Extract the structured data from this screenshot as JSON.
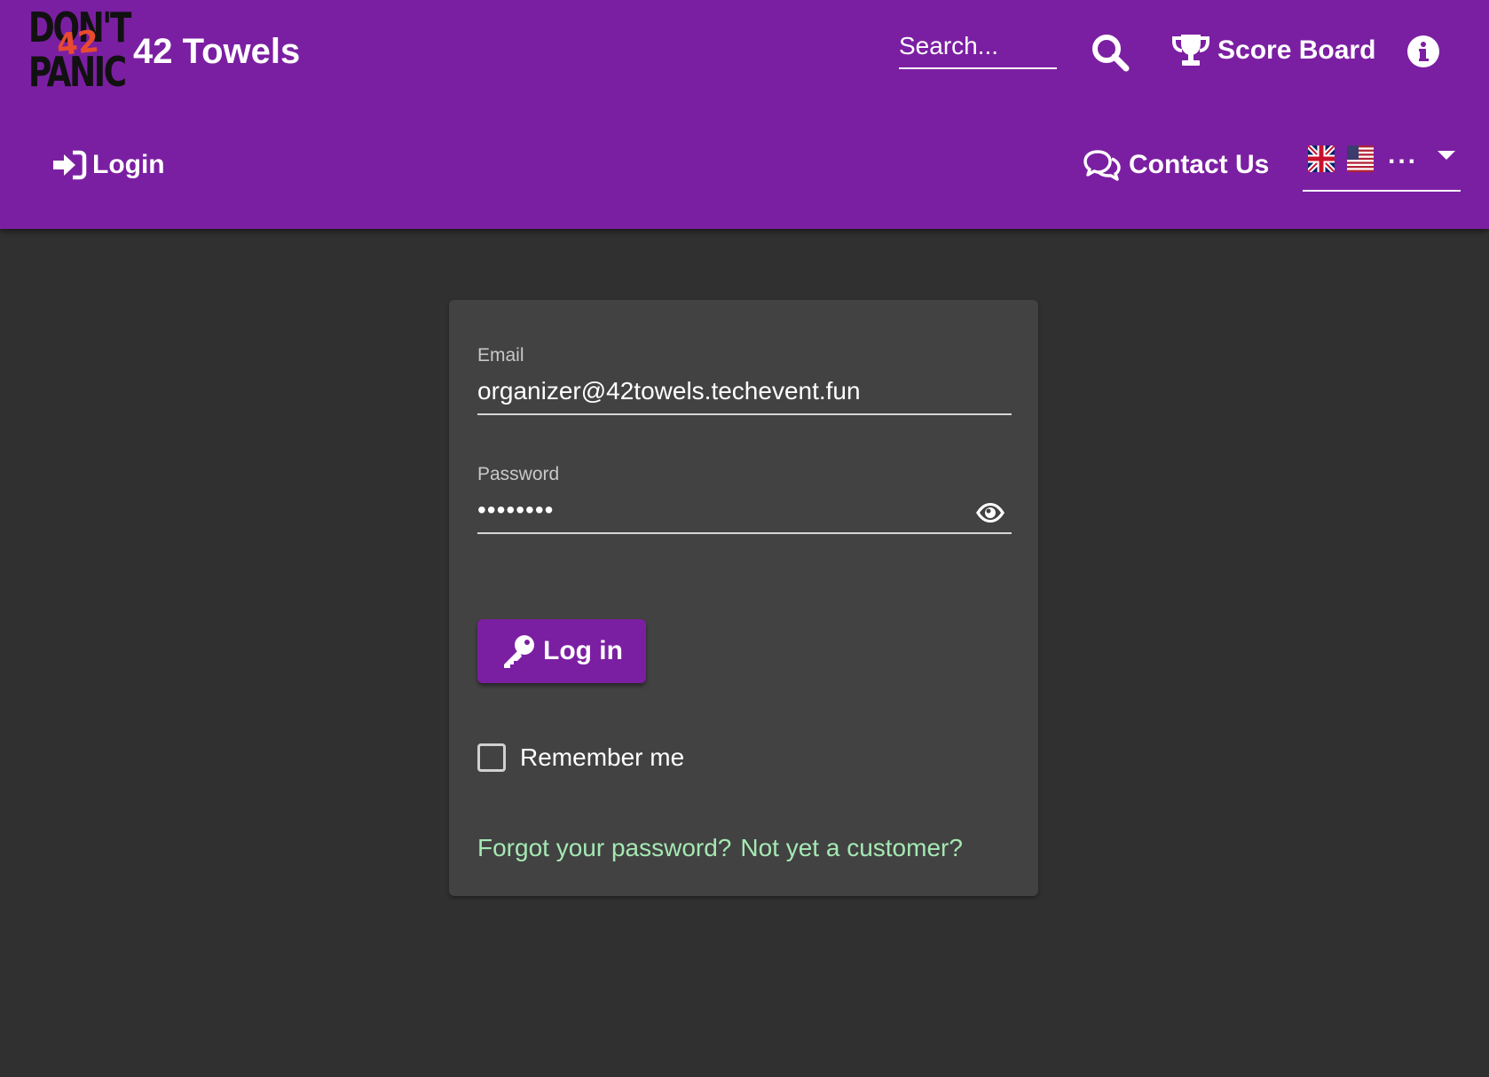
{
  "header": {
    "logo": {
      "line1": "DON'T",
      "line2": "42",
      "line3": "PANIC"
    },
    "app_title": "42 Towels",
    "search_placeholder": "Search...",
    "score_board_label": "Score Board",
    "login_label": "Login",
    "contact_label": "Contact Us",
    "language": {
      "flags": [
        "flag-uk",
        "flag-us"
      ],
      "more_label": "..."
    }
  },
  "login_form": {
    "email_label": "Email",
    "email_value": "organizer@42towels.techevent.fun",
    "password_label": "Password",
    "password_value": "••••••••",
    "login_button_label": "Log in",
    "remember_me_label": "Remember me",
    "remember_me_checked": false,
    "forgot_password_link": "Forgot your password?",
    "register_link": "Not yet a customer?"
  },
  "theme": {
    "primary": "#7b1fa2",
    "background": "#303030",
    "card": "#424242",
    "link": "#a5e8b3"
  },
  "icons": {
    "search": "search-icon",
    "score_board": "trophy-icon",
    "info": "info-icon",
    "login": "sign-in-icon",
    "contact": "comments-icon",
    "show_password": "eye-icon",
    "login_button": "key-icon"
  }
}
